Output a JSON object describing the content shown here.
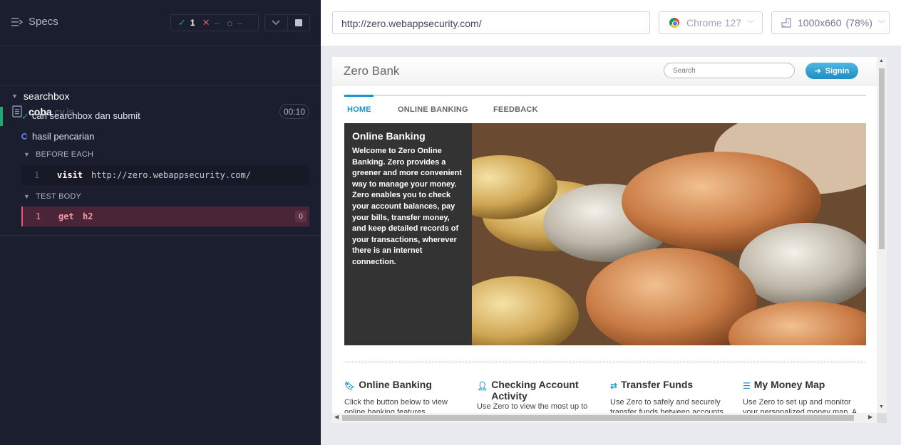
{
  "reporter": {
    "specs_label": "Specs",
    "stats": {
      "passed": "1",
      "failed": "--",
      "pending": "--"
    },
    "spec_file": {
      "name": "coba",
      "ext": ".cy.js",
      "duration": "00:10"
    },
    "suite": "searchbox",
    "tests": [
      {
        "title": "cari searchbox dan submit",
        "state": "passed"
      },
      {
        "title": "hasil pencarian",
        "state": "running"
      }
    ],
    "hooks": {
      "before_each": {
        "title": "BEFORE EACH",
        "commands": [
          {
            "num": "1",
            "name": "visit",
            "message": "http://zero.webappsecurity.com/"
          }
        ]
      },
      "test_body": {
        "title": "TEST BODY",
        "commands": [
          {
            "num": "1",
            "name": "get",
            "message": "h2",
            "count": "0"
          }
        ]
      }
    }
  },
  "browser": {
    "url": "http://zero.webappsecurity.com/",
    "name": "Chrome 127",
    "viewport": "1000x660",
    "scale": "(78%)"
  },
  "site": {
    "brand": "Zero Bank",
    "search_placeholder": "Search",
    "signin": "Signin",
    "nav": [
      "HOME",
      "ONLINE BANKING",
      "FEEDBACK"
    ],
    "hero": {
      "title": "Online Banking",
      "text": "Welcome to Zero Online Banking. Zero provides a greener and more convenient way to manage your money. Zero enables you to check your account balances, pay your bills, transfer money, and keep detailed records of your transactions, wherever there is an internet connection."
    },
    "features": [
      {
        "title": "Online Banking",
        "text": "Click the button below to view online banking features.",
        "icon": "bookmark-icon"
      },
      {
        "title": "Checking Account Activity",
        "text": "Use Zero to view the most up to",
        "icon": "user-icon"
      },
      {
        "title": "Transfer Funds",
        "text": "Use Zero to safely and securely transfer funds between accounts.",
        "icon": "shuffle-icon"
      },
      {
        "title": "My Money Map",
        "text": "Use Zero to set up and monitor your personalized money map. A",
        "icon": "list-icon"
      }
    ]
  },
  "colors": {
    "accent": "#1c93c9",
    "pass": "#1fa971",
    "fail": "#e45770",
    "reporter_bg": "#1b1e2e"
  }
}
